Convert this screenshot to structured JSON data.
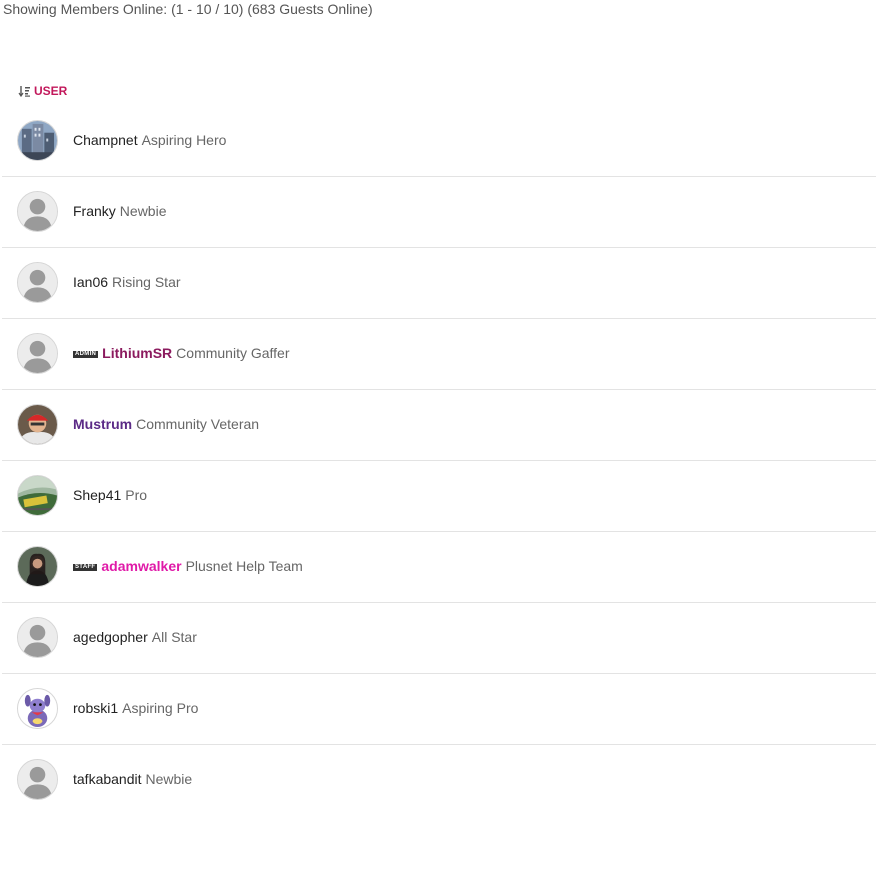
{
  "summary": "Showing Members Online: (1 - 10 / 10) (683 Guests Online)",
  "column_header": {
    "label": "USER",
    "sort_icon": "sort-descending-icon"
  },
  "colors": {
    "accent": "#c2185b",
    "admin_name": "#8b1a5e",
    "veteran_name": "#5b2a86",
    "staff_name": "#e01aa8"
  },
  "members": [
    {
      "username": "Champnet",
      "rank": "Aspiring Hero",
      "badge": "",
      "role": "",
      "avatar": "photo-building"
    },
    {
      "username": "Franky",
      "rank": "Newbie",
      "badge": "",
      "role": "",
      "avatar": "default"
    },
    {
      "username": "Ian06",
      "rank": "Rising Star",
      "badge": "",
      "role": "",
      "avatar": "default"
    },
    {
      "username": "LithiumSR",
      "rank": "Community Gaffer",
      "badge": "ADMIN",
      "role": "admin",
      "avatar": "default"
    },
    {
      "username": "Mustrum",
      "rank": "Community Veteran",
      "badge": "",
      "role": "veteran",
      "avatar": "photo-person-hat"
    },
    {
      "username": "Shep41",
      "rank": "Pro",
      "badge": "",
      "role": "",
      "avatar": "photo-train"
    },
    {
      "username": "adamwalker",
      "rank": "Plusnet Help Team",
      "badge": "STAFF",
      "role": "staff",
      "avatar": "photo-person-dark"
    },
    {
      "username": "agedgopher",
      "rank": "All Star",
      "badge": "",
      "role": "",
      "avatar": "default"
    },
    {
      "username": "robski1",
      "rank": "Aspiring Pro",
      "badge": "",
      "role": "",
      "avatar": "cartoon"
    },
    {
      "username": "tafkabandit",
      "rank": "Newbie",
      "badge": "",
      "role": "",
      "avatar": "default"
    }
  ]
}
